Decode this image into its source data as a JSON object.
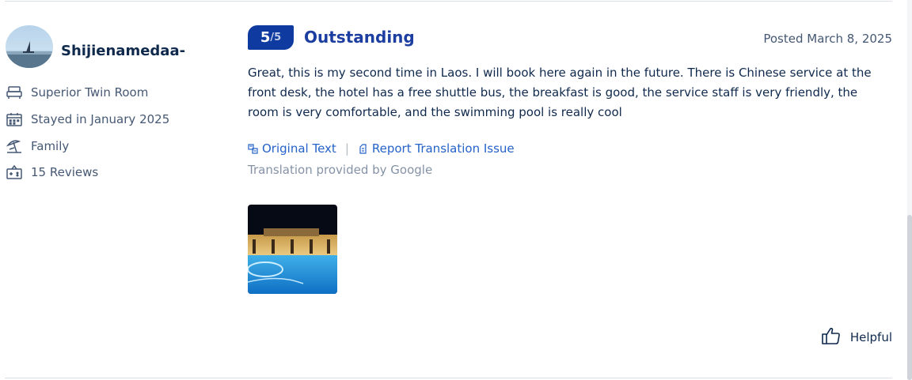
{
  "reviewer": {
    "name": "Shijienamedaa-",
    "avatar_icon": "avatar-photo",
    "room_type": "Superior Twin Room",
    "stay_date": "Stayed in January 2025",
    "traveler_type": "Family",
    "review_count": "15 Reviews"
  },
  "review": {
    "score": "5",
    "score_max": "/5",
    "rating_word": "Outstanding",
    "posted": "Posted March 8, 2025",
    "text": "Great, this is my second time in Laos. I will book here again in the future. There is Chinese service at the front desk, the hotel has a free shuttle bus, the breakfast is good, the service staff is very friendly, the room is very comfortable, and the swimming pool is really cool",
    "original_text_label": "Original Text",
    "separator": "|",
    "report_label": "Report Translation Issue",
    "translation_credit": "Translation provided by Google",
    "helpful_label": "Helpful"
  },
  "colors": {
    "badge": "#0f3aa0",
    "rating_word": "#1d3ea1",
    "link": "#2563c9",
    "text": "#0f294d",
    "muted": "#455873"
  },
  "icons": [
    "bed-icon",
    "calendar-icon",
    "beach-umbrella-icon",
    "reviews-icon",
    "translate-icon",
    "report-icon",
    "thumbs-up-icon"
  ]
}
